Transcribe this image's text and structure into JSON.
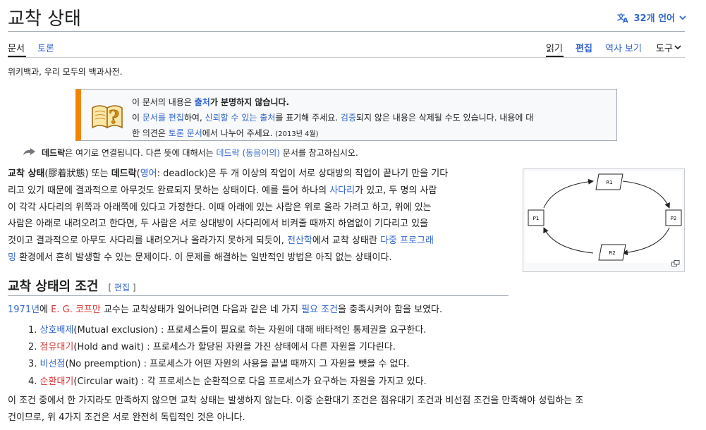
{
  "header": {
    "title": "교착 상태",
    "languages_label": "32개 언어"
  },
  "tabs": {
    "article": "문서",
    "talk": "토론",
    "read": "읽기",
    "edit": "편집",
    "history": "역사 보기",
    "tools": "도구"
  },
  "tagline": "위키백과, 우리 모두의 백과사전.",
  "ambox": {
    "line1_a": "이 문서의 내용은 ",
    "line1_link": "출처",
    "line1_b": "가 분명하지 않습니다.",
    "line2_a": "이 ",
    "line2_link1": "문서를 편집",
    "line2_b": "하여, ",
    "line2_link2": "신뢰할 수 있는 출처",
    "line2_c": "를 표기해 주세요. ",
    "line2_link3": "검증",
    "line2_d": "되지 않은 내용은 삭제될 수도 있습니다. 내용에 대",
    "line3_a": "한 의견은 ",
    "line3_link": "토론 문서",
    "line3_b": "에서 나누어 주세요. ",
    "line3_date": "(2013년 4월)"
  },
  "hatnote": {
    "bold": "데드락",
    "a": "은 여기로 연결됩니다. 다른 뜻에 대해서는 ",
    "link": "데드락 (동음이의)",
    "b": " 문서를 참고하십시오."
  },
  "intro": {
    "l1_bold1": "교착 상태",
    "l1_a": "(膠着狀態) 또는 ",
    "l1_bold2": "데드락",
    "l1_b": "(",
    "l1_link": "영어",
    "l1_c": ": deadlock)은 두 개 이상의 작업이 서로 상대방의 작업이 끝나기 만을 기다",
    "l2_a": "리고 있기 때문에 결과적으로 아무것도 완료되지 못하는 상태이다. 예를 들어 하나의 ",
    "l2_link": "사다리",
    "l2_b": "가 있고, 두 명의 사람",
    "l3": "이 각각 사다리의 위쪽과 아래쪽에 있다고 가정한다. 이때 아래에 있는 사람은 위로 올라 가려고 하고, 위에 있는",
    "l4": "사람은 아래로 내려오려고 한다면, 두 사람은 서로 상대방이 사다리에서 비켜줄 때까지 하염없이 기다리고 있을",
    "l5_a": "것이고 결과적으로 아무도 사다리를 내려오거나 올라가지 못하게 되듯이, ",
    "l5_link1": "전산학",
    "l5_b": "에서 교착 상태란 ",
    "l5_link2": "다중 프로그래",
    "l6_link": "밍",
    "l6_a": " 환경에서 흔히 발생할 수 있는 문제이다. 이 문제를 해결하는 일반적인 방법은 아직 없는 상태이다."
  },
  "figure": {
    "nodes": [
      "P1",
      "P2",
      "R1",
      "R2"
    ]
  },
  "section": {
    "heading": "교착 상태의 조건",
    "edit_open": "[ ",
    "edit_label": "편집",
    "edit_close": " ]"
  },
  "p2": {
    "link1": "1971년",
    "a": "에 ",
    "link2": "E. G. 코프만",
    "b": " 교수는 교착상태가 일어나려면 다음과 같은 네 가지 ",
    "link3": "필요 조건",
    "c": "을 충족시켜야 함을 보였다."
  },
  "conditions": [
    {
      "num": "1.",
      "term": "상호배제",
      "term_color": "#3366cc",
      "desc": "(Mutual exclusion) : 프로세스들이 필요로 하는 자원에 대해 배타적인 통제권을 요구한다."
    },
    {
      "num": "2.",
      "term": "점유대기",
      "term_color": "#d73333",
      "desc": "(Hold and wait) : 프로세스가 할당된 자원을 가진 상태에서 다른 자원을 기다린다."
    },
    {
      "num": "3.",
      "term": "비선점",
      "term_color": "#3366cc",
      "desc": "(No preemption) : 프로세스가 어떤 자원의 사용을 끝낼 때까지 그 자원을 뺏을 수 없다."
    },
    {
      "num": "4.",
      "term": "순환대기",
      "term_color": "#d73333",
      "desc": "(Circular wait) : 각 프로세스는 순환적으로 다음 프로세스가 요구하는 자원을 가지고 있다."
    }
  ],
  "p3": {
    "l1": "이 조건 중에서 한 가지라도 만족하지 않으면 교착 상태는 발생하지 않는다. 이중 순환대기 조건은 점유대기 조건과 비선점 조건을 만족해야 성립하는 조",
    "l2": "건이므로, 위 4가지 조건은 서로 완전히 독립적인 것은 아니다."
  },
  "colors": {
    "link": "#3366cc",
    "redlink": "#d73333",
    "ambox_accent": "#f28500"
  }
}
